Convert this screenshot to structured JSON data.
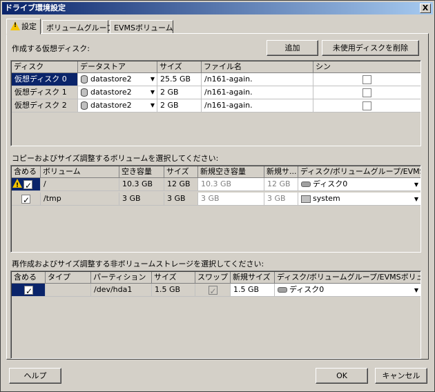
{
  "window": {
    "title": "ドライブ環境設定",
    "close": "X"
  },
  "tabs": [
    "設定",
    "ボリュームグループ",
    "EVMSボリューム"
  ],
  "virtual_disks": {
    "label": "作成する仮想ディスク:",
    "add_button": "追加",
    "delete_unused_button": "未使用ディスクを削除",
    "columns": [
      "ディスク",
      "データストア",
      "サイズ",
      "ファイル名",
      "シン"
    ],
    "rows": [
      {
        "disk": "仮想ディスク 0",
        "datastore": "datastore2",
        "size": "25.5 GB",
        "filename": "/n161-again.",
        "thin": false
      },
      {
        "disk": "仮想ディスク 1",
        "datastore": "datastore2",
        "size": "2 GB",
        "filename": "/n161-again.",
        "thin": false
      },
      {
        "disk": "仮想ディスク 2",
        "datastore": "datastore2",
        "size": "2 GB",
        "filename": "/n161-again.",
        "thin": false
      }
    ]
  },
  "volumes": {
    "label": "コピーおよびサイズ調整するボリュームを選択してください:",
    "columns": [
      "含める",
      "ボリューム",
      "空き容量",
      "サイズ",
      "新規空き容量",
      "新規サ...",
      "ディスク/ボリュームグループ/EVMS..."
    ],
    "rows": [
      {
        "include": true,
        "warning": true,
        "volume": "/",
        "free": "10.3 GB",
        "size": "12 GB",
        "new_free": "10.3 GB",
        "new_size": "12 GB",
        "target": "ディスク0",
        "target_icon": "disk-icon"
      },
      {
        "include": true,
        "warning": false,
        "volume": "/tmp",
        "free": "3 GB",
        "size": "3 GB",
        "new_free": "3 GB",
        "new_size": "3 GB",
        "target": "system",
        "target_icon": "volume-group-icon"
      }
    ]
  },
  "nonvolume": {
    "label": "再作成およびサイズ調整する非ボリュームストレージを選択してください:",
    "columns": [
      "含める",
      "タイプ",
      "パーティション",
      "サイズ",
      "スワップ",
      "新規サイズ",
      "ディスク/ボリュームグループ/EVMSボリューム"
    ],
    "rows": [
      {
        "include": true,
        "type": "",
        "partition": "/dev/hda1",
        "size": "1.5 GB",
        "swap": true,
        "new_size": "1.5 GB",
        "target": "ディスク0"
      }
    ]
  },
  "footer": {
    "help": "ヘルプ",
    "ok": "OK",
    "cancel": "キャンセル"
  },
  "colors": {
    "selection": "#0a246a",
    "face": "#d4d0c8",
    "warning": "#f5c400"
  }
}
